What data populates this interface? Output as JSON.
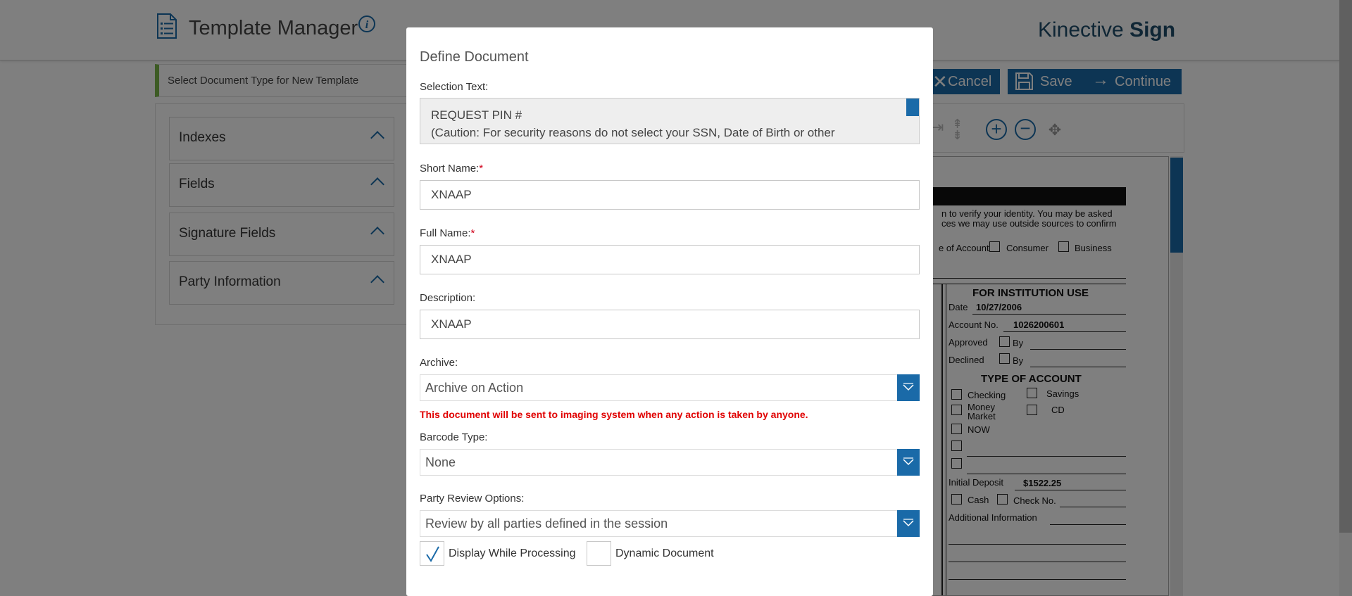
{
  "app": {
    "title": "Template Manager",
    "brand_light": "Kinective",
    "brand_bold": "Sign",
    "accent_color": "#1a6aa8"
  },
  "doc_type_bar": {
    "text": "Select Document Type for New Template"
  },
  "accordions": [
    {
      "label": "Indexes"
    },
    {
      "label": "Fields"
    },
    {
      "label": "Signature Fields"
    },
    {
      "label": "Party Information"
    }
  ],
  "toolbar": {
    "cancel_label": "Cancel",
    "save_label": "Save",
    "continue_label": "Continue"
  },
  "doc_preview": {
    "line1": "n to verify your identity. You may be asked",
    "line2": "ces we may use outside sources to confirm",
    "type_of_account_prefix": "e of Account",
    "consumer": "Consumer",
    "business": "Business",
    "institution_heading": "FOR INSTITUTION USE",
    "date_label": "Date",
    "date_value": "10/27/2006",
    "account_no_label": "Account No.",
    "account_no_value": "1026200601",
    "approved": "Approved",
    "declined": "Declined",
    "by": "By",
    "type_heading": "TYPE OF ACCOUNT",
    "checking": "Checking",
    "savings": "Savings",
    "money_market_1": "Money",
    "money_market_2": "Market",
    "cd": "CD",
    "now": "NOW",
    "initial_deposit_label": "Initial Deposit",
    "initial_deposit_value": "$1522.25",
    "cash": "Cash",
    "check_no": "Check No.",
    "additional_info": "Additional Information"
  },
  "modal": {
    "title": "Define Document",
    "selection_text_label": "Selection Text:",
    "selection_text": "REQUEST PIN #\n(Caution: For security reasons do not select your SSN, Date of Birth or other\n        ...ly ...   ... ...  ... ..  PIN.)",
    "short_name_label": "Short Name:",
    "short_name_value": "XNAAP",
    "full_name_label": "Full Name:",
    "full_name_value": "XNAAP",
    "description_label": "Description:",
    "description_value": "XNAAP",
    "required_mark": "*",
    "archive_label": "Archive:",
    "archive_value": "Archive on Action",
    "archive_warning": "This document will be sent to imaging system when any action is taken by anyone.",
    "barcode_label": "Barcode Type:",
    "barcode_value": "None",
    "party_review_label": "Party Review Options:",
    "party_review_value": "Review by all parties defined in the session",
    "display_while_processing_label": "Display While Processing",
    "display_while_processing_checked": true,
    "dynamic_document_label": "Dynamic Document",
    "dynamic_document_checked": false
  }
}
